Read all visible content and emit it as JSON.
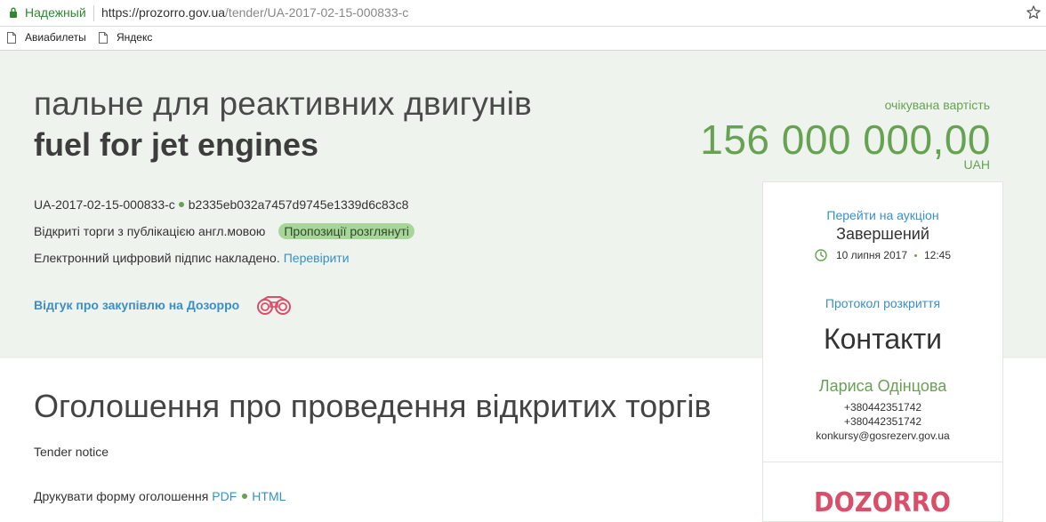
{
  "browser": {
    "secure_label": "Надежный",
    "url_base": "https://prozorro.gov.ua",
    "url_path": "/tender/UA-2017-02-15-000833-c",
    "bookmarks": [
      {
        "label": "Авиабилеты"
      },
      {
        "label": "Яндекс"
      }
    ]
  },
  "tender": {
    "title_ua": "пальне для реактивних двигунів",
    "title_en": "fuel for jet engines",
    "tender_id": "UA-2017-02-15-000833-c",
    "hash": "b2335eb032a7457d9745e1339d6c83c8",
    "procedure_type": "Відкриті торги з публікацією англ.мовою",
    "status_badge": "Пропозиції розглянуті",
    "signature_text": "Електронний цифровий підпис накладено.",
    "verify_link": "Перевірити",
    "dozorro_feedback_link": "Відгук про закупівлю на Дозорро"
  },
  "value": {
    "label": "очікувана вартість",
    "amount": "156 000 000,00",
    "currency": "UAH"
  },
  "auction": {
    "link_label": "Перейти на аукціон",
    "status": "Завершений",
    "date": "10 липня 2017",
    "time": "12:45"
  },
  "sidebar": {
    "protocol_link": "Протокол розкриття",
    "contacts_title": "Контакти",
    "contact_name": "Лариса Одінцова",
    "phone1": "+380442351742",
    "phone2": "+380442351742",
    "email": "konkursy@gosrezerv.gov.ua",
    "logo_text": "DOZORRO"
  },
  "notice": {
    "title": "Оголошення про проведення відкритих торгів",
    "subtitle_en": "Tender notice",
    "print_label": "Друкувати форму оголошення",
    "print_pdf": "PDF",
    "print_html": "HTML"
  },
  "colors": {
    "accent_green": "#67a252",
    "link_blue": "#3b8fc6",
    "dozorro_red": "#d94f6a",
    "hero_bg": "#eef3ee"
  }
}
